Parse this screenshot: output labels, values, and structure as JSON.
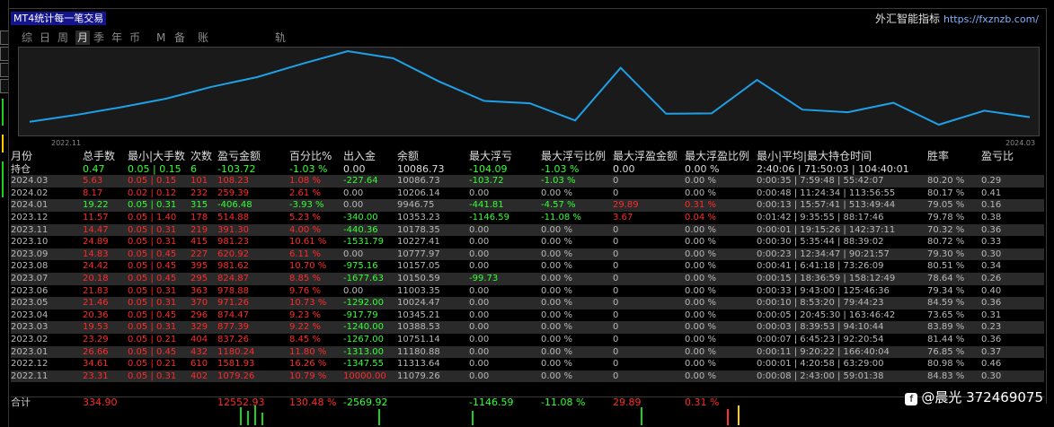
{
  "window": {
    "title": "MT4统计每一笔交易",
    "brand": "外汇智能指标",
    "url": "https://fxznzb.com/"
  },
  "tabs": [
    {
      "label": "综",
      "active": false
    },
    {
      "label": "日",
      "active": false
    },
    {
      "label": "周",
      "active": false
    },
    {
      "label": "月",
      "active": true
    },
    {
      "label": "季",
      "active": false
    },
    {
      "label": "年",
      "active": false
    },
    {
      "label": "币",
      "active": false
    },
    {
      "label": "M",
      "active": false
    },
    {
      "label": "备",
      "active": false
    },
    {
      "label": "账户",
      "active": false
    },
    {
      "label": "轨迹",
      "active": false
    }
  ],
  "chart_data": {
    "type": "line",
    "x_start_label": "2022.11",
    "x_end_label": "2024.03",
    "y": [
      10000.0,
      10125,
      10270,
      10430,
      10650,
      10830,
      11079.26,
      11313.64,
      11180.88,
      10751.14,
      10388.53,
      10345.21,
      10024.47,
      11003.35,
      10150.59,
      10157.05,
      10777.97,
      10227.41,
      10178.35,
      10353.23,
      9946.75,
      10206.14,
      10086.73
    ],
    "color": "#1ea0e8"
  },
  "columns": [
    "月份",
    "总手数",
    "最小|大手数",
    "次数",
    "盈亏金额",
    "百分比%",
    "出入金",
    "余额",
    "最大浮亏",
    "最大浮亏比例",
    "最大浮盈金额",
    "最大浮盈比例",
    "最小|平均|最大持仓时间",
    "胜率",
    "盈亏比"
  ],
  "sub_header": {
    "month": "持仓",
    "total": "0.47",
    "minmax": "0.05 | 0.15",
    "count": "6",
    "pnl": "-103.72",
    "pct": "-1.03 %",
    "io": "0.00",
    "bal": "10086.73",
    "mfl": "-104.09",
    "mflr": "-1.03 %",
    "mfp": "0.00",
    "mfpr": "0.00 %",
    "time": "2:40:06 | 71:50:03 | 104:40:01",
    "win": "",
    "pf": ""
  },
  "rows": [
    {
      "month": "2024.03",
      "total": "5.63",
      "minmax": "0.05 | 0.15",
      "count": "101",
      "pnl": "108.23",
      "pct": "1.08 %",
      "io": "-227.64",
      "bal": "10086.73",
      "mfl": "-103.72",
      "mflr": "-1.03 %",
      "mfp": "0",
      "mfpr": "0.00 %",
      "time": "0:00:35 | 7:59:48 | 55:42:07",
      "win": "80.20 %",
      "pf": "0.29",
      "pos": true
    },
    {
      "month": "2024.02",
      "total": "8.17",
      "minmax": "0.02 | 0.12",
      "count": "232",
      "pnl": "259.39",
      "pct": "2.61 %",
      "io": "0.00",
      "bal": "10206.14",
      "mfl": "0.00",
      "mflr": "0.00 %",
      "mfp": "0",
      "mfpr": "0.00 %",
      "time": "0:00:48 | 11:24:34 | 113:56:55",
      "win": "80.17 %",
      "pf": "0.41",
      "pos": true
    },
    {
      "month": "2024.01",
      "total": "19.22",
      "minmax": "0.05 | 0.31",
      "count": "315",
      "pnl": "-406.48",
      "pct": "-3.93 %",
      "io": "0.00",
      "bal": "9946.75",
      "mfl": "-441.81",
      "mflr": "-4.57 %",
      "mfp": "29.89",
      "mfpr": "0.31 %",
      "time": "0:00:13 | 15:57:41 | 513:49:44",
      "win": "79.05 %",
      "pf": "0.16",
      "pos": false
    },
    {
      "month": "2023.12",
      "total": "11.57",
      "minmax": "0.05 | 1.40",
      "count": "178",
      "pnl": "514.88",
      "pct": "5.23 %",
      "io": "-340.00",
      "bal": "10353.23",
      "mfl": "-1146.59",
      "mflr": "-11.08 %",
      "mfp": "3.67",
      "mfpr": "0.04 %",
      "time": "0:01:42 | 9:35:55 | 88:17:46",
      "win": "79.78 %",
      "pf": "0.38",
      "pos": true
    },
    {
      "month": "2023.11",
      "total": "14.47",
      "minmax": "0.05 | 0.31",
      "count": "219",
      "pnl": "391.30",
      "pct": "4.00 %",
      "io": "-440.36",
      "bal": "10178.35",
      "mfl": "0.00",
      "mflr": "0.00 %",
      "mfp": "0",
      "mfpr": "0.00 %",
      "time": "0:00:01 | 19:15:26 | 142:37:11",
      "win": "70.32 %",
      "pf": "0.36",
      "pos": true
    },
    {
      "month": "2023.10",
      "total": "24.89",
      "minmax": "0.05 | 0.31",
      "count": "415",
      "pnl": "981.23",
      "pct": "10.61 %",
      "io": "-1531.79",
      "bal": "10227.41",
      "mfl": "0.00",
      "mflr": "0.00 %",
      "mfp": "0",
      "mfpr": "0.00 %",
      "time": "0:00:30 | 5:35:44 | 88:39:02",
      "win": "80.72 %",
      "pf": "0.33",
      "pos": true
    },
    {
      "month": "2023.09",
      "total": "14.83",
      "minmax": "0.05 | 0.45",
      "count": "227",
      "pnl": "620.92",
      "pct": "6.11 %",
      "io": "0.00",
      "bal": "10777.97",
      "mfl": "0.00",
      "mflr": "0.00 %",
      "mfp": "0",
      "mfpr": "0.00 %",
      "time": "0:00:23 | 12:34:47 | 90:21:57",
      "win": "79.30 %",
      "pf": "0.30",
      "pos": true
    },
    {
      "month": "2023.08",
      "total": "24.42",
      "minmax": "0.05 | 0.45",
      "count": "395",
      "pnl": "981.62",
      "pct": "10.70 %",
      "io": "-975.16",
      "bal": "10157.05",
      "mfl": "0.00",
      "mflr": "0.00 %",
      "mfp": "0",
      "mfpr": "0.00 %",
      "time": "0:00:41 | 6:41:18 | 73:26:09",
      "win": "80.51 %",
      "pf": "0.34",
      "pos": true
    },
    {
      "month": "2023.07",
      "total": "20.18",
      "minmax": "0.05 | 0.45",
      "count": "295",
      "pnl": "824.87",
      "pct": "8.85 %",
      "io": "-1677.63",
      "bal": "10150.59",
      "mfl": "-99.73",
      "mflr": "0.00 %",
      "mfp": "0",
      "mfpr": "0.00 %",
      "time": "0:00:15 | 18:36:59 | 158:12:49",
      "win": "78.64 %",
      "pf": "0.26",
      "pos": true
    },
    {
      "month": "2023.06",
      "total": "21.83",
      "minmax": "0.05 | 0.31",
      "count": "363",
      "pnl": "978.88",
      "pct": "9.76 %",
      "io": "0.00",
      "bal": "11003.35",
      "mfl": "0.00",
      "mflr": "0.00 %",
      "mfp": "0",
      "mfpr": "0.00 %",
      "time": "0:00:33 | 9:43:00 | 125:46:36",
      "win": "79.34 %",
      "pf": "0.40",
      "pos": true
    },
    {
      "month": "2023.05",
      "total": "21.46",
      "minmax": "0.05 | 0.31",
      "count": "370",
      "pnl": "971.26",
      "pct": "10.73 %",
      "io": "-1292.00",
      "bal": "10024.47",
      "mfl": "0.00",
      "mflr": "0.00 %",
      "mfp": "0",
      "mfpr": "0.00 %",
      "time": "0:00:10 | 8:53:20 | 79:44:23",
      "win": "84.59 %",
      "pf": "0.36",
      "pos": true
    },
    {
      "month": "2023.04",
      "total": "20.36",
      "minmax": "0.05 | 0.45",
      "count": "296",
      "pnl": "874.47",
      "pct": "9.23 %",
      "io": "-917.79",
      "bal": "10345.21",
      "mfl": "0.00",
      "mflr": "0.00 %",
      "mfp": "0",
      "mfpr": "0.00 %",
      "time": "0:00:05 | 20:45:30 | 163:46:42",
      "win": "73.65 %",
      "pf": "0.31",
      "pos": true
    },
    {
      "month": "2023.03",
      "total": "19.53",
      "minmax": "0.05 | 0.31",
      "count": "329",
      "pnl": "877.39",
      "pct": "9.22 %",
      "io": "-1240.00",
      "bal": "10388.53",
      "mfl": "0.00",
      "mflr": "0.00 %",
      "mfp": "0",
      "mfpr": "0.00 %",
      "time": "0:00:03 | 8:39:53 | 94:10:44",
      "win": "83.89 %",
      "pf": "0.23",
      "pos": true
    },
    {
      "month": "2023.02",
      "total": "23.29",
      "minmax": "0.05 | 0.21",
      "count": "404",
      "pnl": "837.26",
      "pct": "8.45 %",
      "io": "-1267.00",
      "bal": "10751.14",
      "mfl": "0.00",
      "mflr": "0.00 %",
      "mfp": "0",
      "mfpr": "0.00 %",
      "time": "0:00:07 | 6:45:23 | 92:20:54",
      "win": "81.44 %",
      "pf": "0.36",
      "pos": true
    },
    {
      "month": "2023.01",
      "total": "26.66",
      "minmax": "0.05 | 0.45",
      "count": "432",
      "pnl": "1180.24",
      "pct": "11.80 %",
      "io": "-1313.00",
      "bal": "11180.88",
      "mfl": "0.00",
      "mflr": "0.00 %",
      "mfp": "0",
      "mfpr": "0.00 %",
      "time": "0:00:11 | 9:20:22 | 166:40:04",
      "win": "76.85 %",
      "pf": "0.37",
      "pos": true
    },
    {
      "month": "2022.12",
      "total": "34.61",
      "minmax": "0.05 | 0.21",
      "count": "610",
      "pnl": "1581.93",
      "pct": "16.26 %",
      "io": "-1347.55",
      "bal": "11313.64",
      "mfl": "0.00",
      "mflr": "0.00 %",
      "mfp": "0",
      "mfpr": "0.00 %",
      "time": "0:00:01 | 4:20:58 | 63:29:00",
      "win": "80.98 %",
      "pf": "0.46",
      "pos": true
    },
    {
      "month": "2022.11",
      "total": "23.31",
      "minmax": "0.05 | 0.31",
      "count": "402",
      "pnl": "1079.26",
      "pct": "10.79 %",
      "io": "10000.00",
      "bal": "11079.26",
      "mfl": "0.00",
      "mflr": "0.00 %",
      "mfp": "0",
      "mfpr": "0.00 %",
      "time": "0:00:08 | 2:43:00 | 59:01:38",
      "win": "84.83 %",
      "pf": "0.30",
      "pos": true
    }
  ],
  "totals": {
    "month": "合计",
    "total": "334.90",
    "pnl": "12552.93",
    "pct": "130.48 %",
    "io": "-2569.92",
    "mfl": "-1146.59",
    "mflr": "-11.08 %",
    "mfp": "29.89",
    "mfpr": "0.31 %"
  },
  "watermark": "@晨光 372469075"
}
